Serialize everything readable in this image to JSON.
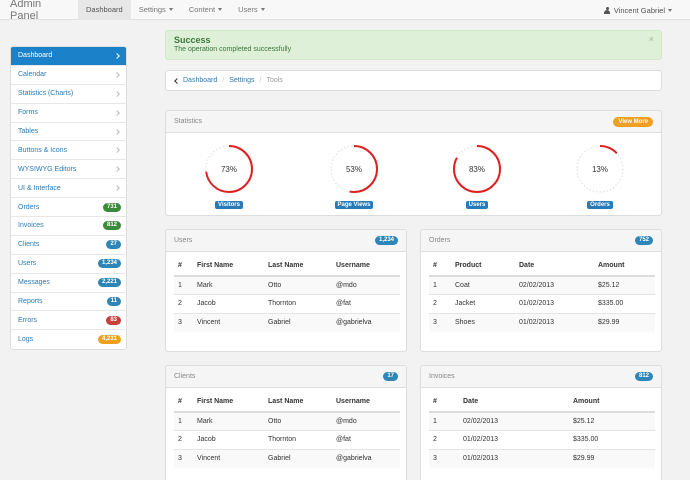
{
  "navbar": {
    "brand": "Admin Panel",
    "items": [
      {
        "label": "Dashboard",
        "active": true,
        "dropdown": false
      },
      {
        "label": "Settings",
        "active": false,
        "dropdown": true
      },
      {
        "label": "Content",
        "active": false,
        "dropdown": true
      },
      {
        "label": "Users",
        "active": false,
        "dropdown": true
      }
    ],
    "user": "Vincent Gabriel"
  },
  "sidebar": {
    "items": [
      {
        "label": "Dashboard",
        "active": true
      },
      {
        "label": "Calendar"
      },
      {
        "label": "Statistics (Charts)"
      },
      {
        "label": "Forms"
      },
      {
        "label": "Tables"
      },
      {
        "label": "Buttons & Icons"
      },
      {
        "label": "WYSIWYG Editors"
      },
      {
        "label": "UI & Interface"
      },
      {
        "label": "Orders",
        "badge": "731",
        "color": "#3c8a3c"
      },
      {
        "label": "Invoices",
        "badge": "812",
        "color": "#3c8a3c"
      },
      {
        "label": "Clients",
        "badge": "27",
        "color": "#2e86b8"
      },
      {
        "label": "Users",
        "badge": "1,234",
        "color": "#2e86b8"
      },
      {
        "label": "Messages",
        "badge": "2,221",
        "color": "#2e86b8"
      },
      {
        "label": "Reports",
        "badge": "11",
        "color": "#2e86b8"
      },
      {
        "label": "Errors",
        "badge": "83",
        "color": "#c9403a"
      },
      {
        "label": "Logs",
        "badge": "4,231",
        "color": "#f0a020"
      }
    ]
  },
  "alert": {
    "title": "Success",
    "message": "The operation completed successfully",
    "close": "×"
  },
  "breadcrumb": {
    "items": [
      "Dashboard",
      "Settings"
    ],
    "current": "Tools"
  },
  "statistics": {
    "title": "Statistics",
    "button": "View More",
    "gauges": [
      {
        "value": 73,
        "text": "73%",
        "label": "Visitors"
      },
      {
        "value": 53,
        "text": "53%",
        "label": "Page Views"
      },
      {
        "value": 83,
        "text": "83%",
        "label": "Users"
      },
      {
        "value": 13,
        "text": "13%",
        "label": "Orders"
      }
    ],
    "colors": {
      "arc": "#e02020",
      "track": "#dddddd",
      "tag": "#2a7ab8"
    }
  },
  "panels": {
    "users": {
      "title": "Users",
      "badge": "1,234",
      "badge_color": "#2e86b8",
      "headers": [
        "#",
        "First Name",
        "Last Name",
        "Username"
      ],
      "rows": [
        [
          "1",
          "Mark",
          "Otto",
          "@mdo"
        ],
        [
          "2",
          "Jacob",
          "Thornton",
          "@fat"
        ],
        [
          "3",
          "Vincent",
          "Gabriel",
          "@gabrielva"
        ]
      ]
    },
    "orders": {
      "title": "Orders",
      "badge": "752",
      "badge_color": "#2e86b8",
      "headers": [
        "#",
        "Product",
        "Date",
        "Amount"
      ],
      "rows": [
        [
          "1",
          "Coat",
          "02/02/2013",
          "$25.12"
        ],
        [
          "2",
          "Jacket",
          "01/02/2013",
          "$335.00"
        ],
        [
          "3",
          "Shoes",
          "01/02/2013",
          "$29.99"
        ]
      ]
    },
    "clients": {
      "title": "Clients",
      "badge": "17",
      "badge_color": "#2e86b8",
      "headers": [
        "#",
        "First Name",
        "Last Name",
        "Username"
      ],
      "rows": [
        [
          "1",
          "Mark",
          "Otto",
          "@mdo"
        ],
        [
          "2",
          "Jacob",
          "Thornton",
          "@fat"
        ],
        [
          "3",
          "Vincent",
          "Gabriel",
          "@gabrielva"
        ]
      ]
    },
    "invoices": {
      "title": "Invoices",
      "badge": "812",
      "badge_color": "#2e86b8",
      "headers": [
        "#",
        "Date",
        "Amount"
      ],
      "rows": [
        [
          "1",
          "02/02/2013",
          "$25.12"
        ],
        [
          "2",
          "01/02/2013",
          "$335.00"
        ],
        [
          "3",
          "01/02/2013",
          "$29.99"
        ]
      ]
    }
  }
}
